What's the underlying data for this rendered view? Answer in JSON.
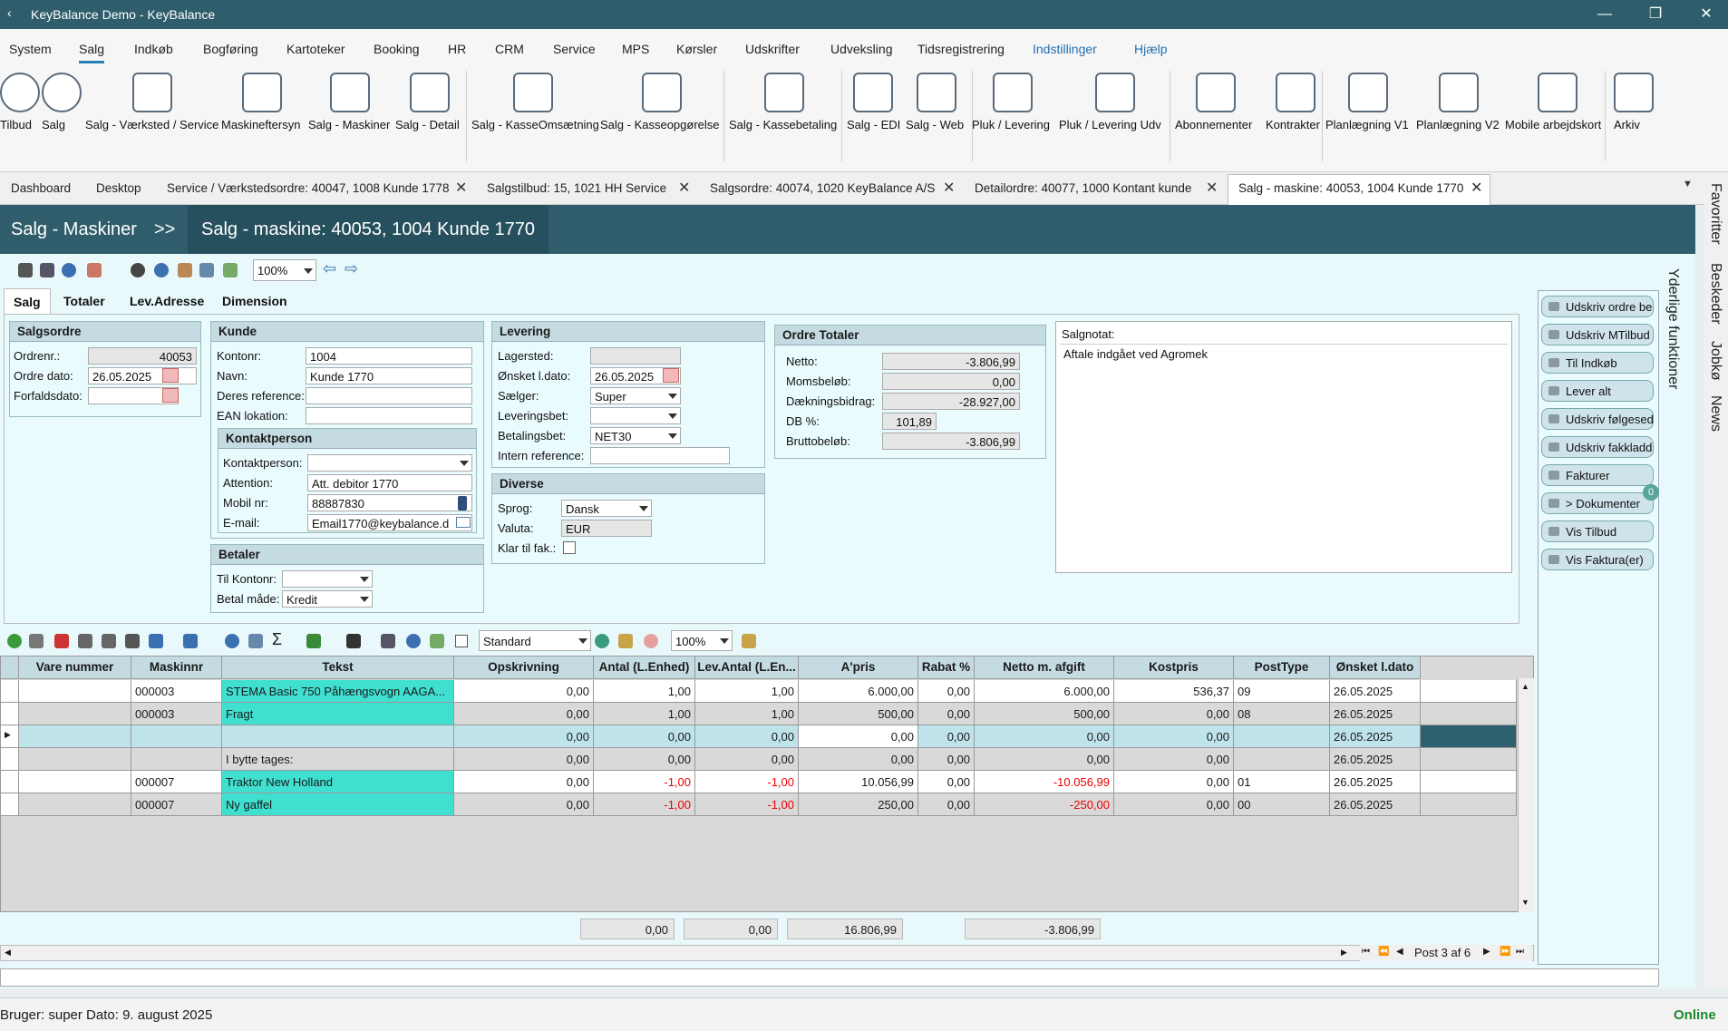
{
  "window": {
    "title": "KeyBalance Demo - KeyBalance",
    "minimize": "—",
    "maximize": "❐",
    "close": "✕"
  },
  "menu": [
    "System",
    "Salg",
    "Indkøb",
    "Bogføring",
    "Kartoteker",
    "Booking",
    "HR",
    "CRM",
    "Service",
    "MPS",
    "Kørsler",
    "Udskrifter",
    "Udveksling",
    "Tidsregistrering",
    "Indstillinger",
    "Hjælp"
  ],
  "ribbon": [
    "Tilbud",
    "Salg",
    "Salg - Værksted / Service",
    "Maskineftersyn",
    "Salg - Maskiner",
    "Salg - Detail",
    "Salg - KasseOmsætning",
    "Salg - Kasseopgørelse",
    "Salg - Kassebetaling",
    "Salg - EDI",
    "Salg - Web",
    "Pluk / Levering",
    "Pluk / Levering Udv",
    "Abonnementer",
    "Kontrakter",
    "Planlægning V1",
    "Planlægning V2",
    "Mobile arbejdskort",
    "Arkiv"
  ],
  "doctabs": [
    "Dashboard",
    "Desktop",
    "Service / Værkstedsordre: 40047, 1008 Kunde 1778",
    "Salgstilbud: 15, 1021 HH Service",
    "Salgsordre: 40074, 1020 KeyBalance A/S",
    "Detailordre: 40077, 1000 Kontant kunde",
    "Salg - maskine: 40053, 1004 Kunde 1770"
  ],
  "sidetabs": [
    "Favoritter",
    "Beskeder",
    "Jobkø",
    "News"
  ],
  "extra": "Yderlige funktioner",
  "header": {
    "section": "Salg - Maskiner",
    "sep": ">>",
    "title": "Salg - maskine: 40053, 1004 Kunde 1770"
  },
  "toolbar": {
    "zoom": "100%"
  },
  "ptabs": [
    "Salg",
    "Totaler",
    "Lev.Adresse",
    "Dimension"
  ],
  "salgsordre": {
    "title": "Salgsordre",
    "ordrenr_l": "Ordrenr.:",
    "ordrenr": "40053",
    "dato_l": "Ordre dato:",
    "dato": "26.05.2025",
    "forf_l": "Forfaldsdato:",
    "forf": ""
  },
  "kunde": {
    "title": "Kunde",
    "kontonr_l": "Kontonr:",
    "kontonr": "1004",
    "navn_l": "Navn:",
    "navn": "Kunde 1770",
    "ref_l": "Deres reference:",
    "ref": "",
    "ean_l": "EAN lokation:",
    "ean": ""
  },
  "kontakt": {
    "title": "Kontaktperson",
    "kp_l": "Kontaktperson:",
    "kp": "",
    "att_l": "Attention:",
    "att": "Att. debitor 1770",
    "mobil_l": "Mobil nr:",
    "mobil": "88887830",
    "email_l": "E-mail:",
    "email": "Email1770@keybalance.d"
  },
  "betaler": {
    "title": "Betaler",
    "til_l": "Til Kontonr:",
    "til": "",
    "maade_l": "Betal måde:",
    "maade": "Kredit"
  },
  "levering": {
    "title": "Levering",
    "lager_l": "Lagersted:",
    "lager": "",
    "onsk_l": "Ønsket l.dato:",
    "onsk": "26.05.2025",
    "saelger_l": "Sælger:",
    "saelger": "Super",
    "levbet_l": "Leveringsbet:",
    "levbet": "",
    "betbet_l": "Betalingsbet:",
    "betbet": "NET30",
    "intern_l": "Intern reference:",
    "intern": ""
  },
  "diverse": {
    "title": "Diverse",
    "sprog_l": "Sprog:",
    "sprog": "Dansk",
    "valuta_l": "Valuta:",
    "valuta": "EUR",
    "klar_l": "Klar til fak.:"
  },
  "totaler": {
    "title": "Ordre Totaler",
    "netto_l": "Netto:",
    "netto": "-3.806,99",
    "moms_l": "Momsbeløb:",
    "moms": "0,00",
    "daek_l": "Dækningsbidrag:",
    "daek": "-28.927,00",
    "db_l": "DB %:",
    "db": "101,89",
    "brutto_l": "Bruttobeløb:",
    "brutto": "-3.806,99"
  },
  "notat": {
    "label": "Salgnotat:",
    "text": "Aftale indgået ved Agromek"
  },
  "actions": [
    "Udskriv ordre be",
    "Udskriv MTilbud",
    "Til Indkøb",
    "Lever alt",
    "Udskriv følgesed",
    "Udskriv fakkladd",
    "Fakturer",
    "> Dokumenter",
    "Vis Tilbud",
    "Vis Faktura(er)"
  ],
  "doc_badge": "0",
  "gridbar": {
    "view": "Standard",
    "zoom": "100%"
  },
  "grid": {
    "headers": [
      "Vare nummer",
      "Maskinnr",
      "Tekst",
      "Opskrivning",
      "Antal (L.Enhed)",
      "Lev.Antal (L.En...",
      "A'pris",
      "Rabat %",
      "Netto m. afgift",
      "Kostpris",
      "PostType",
      "Ønsket l.dato"
    ],
    "rows": [
      [
        "",
        "000003",
        "STEMA Basic 750 Påhængsvogn AAGA...",
        "0,00",
        "1,00",
        "1,00",
        "6.000,00",
        "0,00",
        "6.000,00",
        "536,37",
        "09",
        "26.05.2025"
      ],
      [
        "",
        "000003",
        "Fragt",
        "0,00",
        "1,00",
        "1,00",
        "500,00",
        "0,00",
        "500,00",
        "0,00",
        "08",
        "26.05.2025"
      ],
      [
        "",
        "",
        "",
        "0,00",
        "0,00",
        "0,00",
        "0,00",
        "0,00",
        "0,00",
        "0,00",
        "",
        "26.05.2025"
      ],
      [
        "",
        "",
        "I bytte tages:",
        "0,00",
        "0,00",
        "0,00",
        "0,00",
        "0,00",
        "0,00",
        "0,00",
        "",
        "26.05.2025"
      ],
      [
        "",
        "000007",
        "Traktor New Holland",
        "0,00",
        "-1,00",
        "-1,00",
        "10.056,99",
        "0,00",
        "-10.056,99",
        "0,00",
        "01",
        "26.05.2025"
      ],
      [
        "",
        "000007",
        "Ny gaffel",
        "0,00",
        "-1,00",
        "-1,00",
        "250,00",
        "0,00",
        "-250,00",
        "0,00",
        "00",
        "26.05.2025"
      ]
    ],
    "sums": [
      "0,00",
      "0,00",
      "16.806,99",
      "-3.806,99"
    ],
    "pager": "Post 3 af 6"
  },
  "status": {
    "user": "Bruger:  super  Dato:  9. august 2025",
    "online": "Online"
  }
}
